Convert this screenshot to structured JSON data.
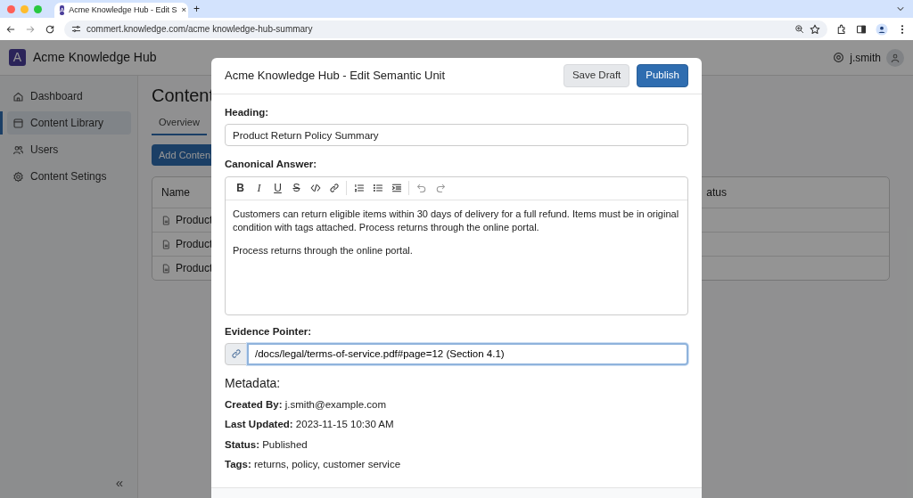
{
  "browser": {
    "favicon_letter": "A",
    "tab_title": "Acme Knowledge Hub - Edit S",
    "tab_close": "×",
    "new_tab": "+",
    "url": "commert.knowledge.com/acme knowledge-hub-summary"
  },
  "app": {
    "logo_letter": "A",
    "title": "Acme Knowledge Hub",
    "user": "j.smith"
  },
  "sidebar": {
    "items": [
      {
        "label": "Dashboard",
        "kind": "home",
        "selected": false
      },
      {
        "label": "Content Library",
        "kind": "library",
        "selected": true
      },
      {
        "label": "Users",
        "kind": "users",
        "selected": false
      },
      {
        "label": "Content Setings",
        "kind": "settings",
        "selected": false
      }
    ],
    "collapse": "«"
  },
  "page": {
    "title": "Content",
    "tabs": [
      {
        "label": "Overview",
        "selected": true
      }
    ],
    "add_button": "Add Conten",
    "table": {
      "columns": [
        "Name",
        "atus"
      ],
      "rows": [
        {
          "name": "Product"
        },
        {
          "name": "Product"
        },
        {
          "name": "Product"
        }
      ]
    }
  },
  "modal": {
    "title": "Acme Knowledge Hub - Edit Semantic Unit",
    "buttons": [
      {
        "label": "Save Draft",
        "kind": "secondary"
      },
      {
        "label": "Publish",
        "kind": "primary"
      }
    ],
    "heading": {
      "label": "Heading:",
      "value": "Product Return Policy Summary"
    },
    "canonical": {
      "label": "Canonical Answer:",
      "toolbar": [
        [
          {
            "kind": "bold",
            "glyph": "B",
            "disabled": false
          },
          {
            "kind": "italic",
            "glyph": "I",
            "disabled": false
          },
          {
            "kind": "underline",
            "glyph": "U",
            "disabled": false
          },
          {
            "kind": "strike",
            "glyph": "S",
            "disabled": false
          },
          {
            "kind": "code",
            "disabled": false
          },
          {
            "kind": "link",
            "disabled": false
          }
        ],
        [
          {
            "kind": "ordered-list",
            "disabled": false
          },
          {
            "kind": "bullet-list",
            "disabled": false
          },
          {
            "kind": "indent",
            "disabled": false
          }
        ],
        [
          {
            "kind": "undo",
            "disabled": true
          },
          {
            "kind": "redo",
            "disabled": true
          }
        ]
      ],
      "paragraphs": [
        "Customers can return eligible items within 30 days of delivery for a full refund. Items must be in original condition with tags attached. Process returns through the online portal.",
        "Process returns through the online portal."
      ]
    },
    "evidence": {
      "label": "Evidence Pointer:",
      "value": "/docs/legal/terms-of-service.pdf#page=12 (Section 4.1)",
      "focused": true
    },
    "metadata": {
      "title": "Metadata:",
      "fields": [
        {
          "label": "Created By:",
          "value": "j.smith@example.com"
        },
        {
          "label": "Last Updated:",
          "value": "2023-11-15 10:30 AM"
        },
        {
          "label": "Status:",
          "value": "Published"
        },
        {
          "label": "Tags:",
          "value": "returns, policy, customer service"
        }
      ]
    }
  }
}
